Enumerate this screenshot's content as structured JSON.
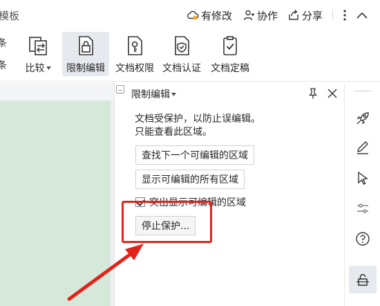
{
  "topbar": {
    "partial_title": "模板",
    "modified_label": "有修改",
    "collab_label": "协作",
    "share_label": "分享"
  },
  "ribbon": {
    "left_partial_1": "条",
    "left_partial_2": "条",
    "buttons": {
      "compare": "比较",
      "restrict_edit": "限制编辑",
      "doc_permission": "文档权限",
      "doc_certify": "文档认证",
      "doc_finalize": "文档定稿"
    }
  },
  "pane": {
    "title": "限制编辑",
    "desc_line1": "文档受保护，以防止误编辑。",
    "desc_line2": "只能查看此区域。",
    "find_next_label": "查找下一个可编辑的区域",
    "show_all_label": "显示可编辑的所有区域",
    "highlight_label": "突出显示可编辑的区域",
    "highlight_checked": true,
    "stop_protect_label": "停止保护..."
  },
  "colors": {
    "annotation_red": "#e2231a",
    "active_bg": "#e6e9ee",
    "doc_green": "#d5e8da"
  },
  "icons": {
    "right_toolbar": [
      "rocket-icon",
      "pen-icon",
      "cursor-icon",
      "sliders-icon",
      "help-icon",
      "lock-icon"
    ]
  }
}
